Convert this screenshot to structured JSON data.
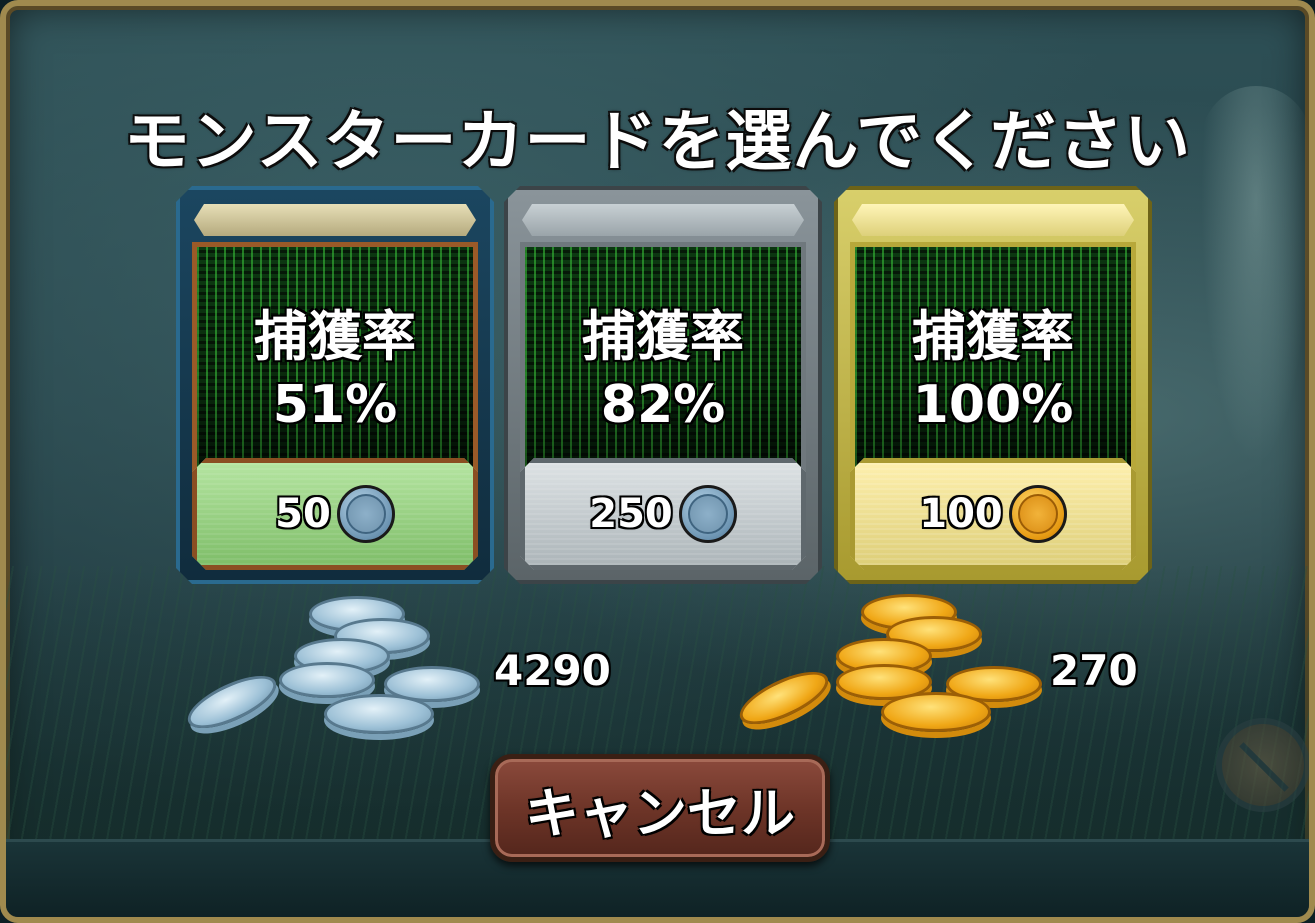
{
  "dialog": {
    "title": "モンスターカードを選んでください"
  },
  "cards": [
    {
      "rate_label": "捕獲率",
      "rate_value": "51%",
      "cost": "50",
      "currency": "silver-coin-icon",
      "tier": "bronze"
    },
    {
      "rate_label": "捕獲率",
      "rate_value": "82%",
      "cost": "250",
      "currency": "silver-coin-icon",
      "tier": "silver"
    },
    {
      "rate_label": "捕獲率",
      "rate_value": "100%",
      "cost": "100",
      "currency": "gold-coin-icon",
      "tier": "gold"
    }
  ],
  "balances": {
    "silver": "4290",
    "gold": "270"
  },
  "cancel_button": {
    "label": "キャンセル"
  },
  "colors": {
    "frame": "#a08a4e",
    "silver_coin": "#8db0c9",
    "gold_coin": "#f0a716",
    "cancel_bg": "#6e3528"
  }
}
